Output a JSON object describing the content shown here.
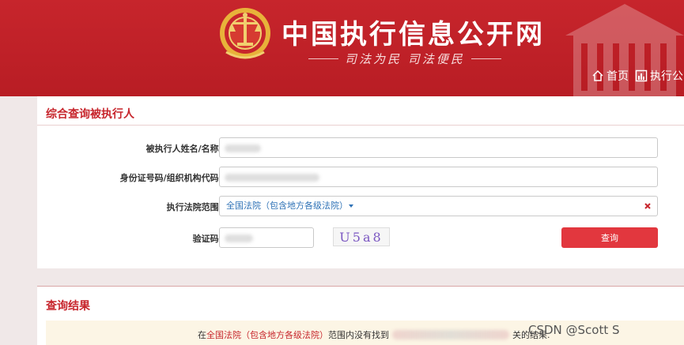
{
  "header": {
    "site_title": "中国执行信息公开网",
    "slogan": "司法为民  司法便民",
    "nav": [
      {
        "label": "首页",
        "icon": "home-icon"
      },
      {
        "label": "执行公",
        "icon": "chart-icon"
      }
    ]
  },
  "query_panel": {
    "title": "综合查询被执行人",
    "name_label": "被执行人姓名/名称:",
    "id_label": "身份证号码/组织机构代码:",
    "court_label": "执行法院范围:",
    "court_selected": "全国法院（包含地方各级法院）",
    "captcha_label": "验证码:",
    "captcha_text": "U5a8",
    "search_label": "查询"
  },
  "result_panel": {
    "title": "查询结果",
    "msg_prefix": "在",
    "msg_highlight": "全国法院（包含地方各级法院）",
    "msg_middle": "范围内没有找到",
    "msg_suffix": "关的结果."
  },
  "watermark": "CSDN @Scott S",
  "colors": {
    "brand": "#c7252c",
    "button": "#e2373e",
    "link": "#2f72b6"
  }
}
